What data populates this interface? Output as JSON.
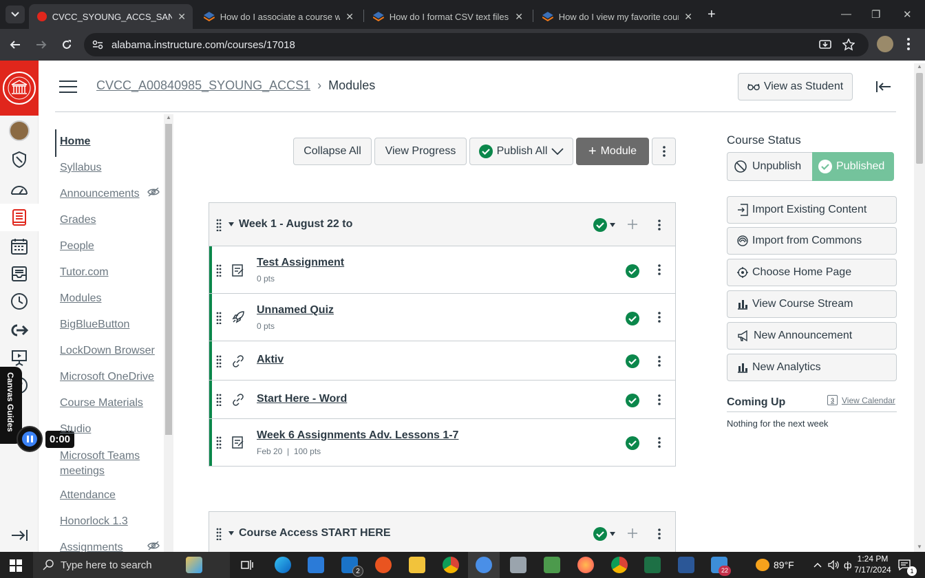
{
  "browser": {
    "tabs": [
      {
        "title": "CVCC_SYOUNG_ACCS_SANDBOX",
        "active": true
      },
      {
        "title": "How do I associate a course with",
        "active": false
      },
      {
        "title": "How do I format CSV text files f",
        "active": false
      },
      {
        "title": "How do I view my favorite cour",
        "active": false
      }
    ],
    "new_tab": "+",
    "url": "alabama.instructure.com/courses/17018"
  },
  "header": {
    "course": "CVCC_A00840985_SYOUNG_ACCS1",
    "separator": "›",
    "page": "Modules",
    "view_as_student": "View as Student"
  },
  "course_nav": [
    {
      "label": "Home",
      "active": true,
      "hidden": false
    },
    {
      "label": "Syllabus",
      "hidden": false
    },
    {
      "label": "Announcements",
      "hidden": true
    },
    {
      "label": "Grades",
      "hidden": false
    },
    {
      "label": "People",
      "hidden": false
    },
    {
      "label": "Tutor.com",
      "hidden": false
    },
    {
      "label": "Modules",
      "hidden": false
    },
    {
      "label": "BigBlueButton",
      "hidden": false
    },
    {
      "label": "LockDown Browser",
      "hidden": false
    },
    {
      "label": "Microsoft OneDrive",
      "hidden": false
    },
    {
      "label": "Course Materials",
      "hidden": false
    },
    {
      "label": "Studio",
      "hidden": false
    },
    {
      "label": "Microsoft Teams meetings",
      "hidden": false
    },
    {
      "label": "Attendance",
      "hidden": false
    },
    {
      "label": "Honorlock 1.3",
      "hidden": false
    },
    {
      "label": "Assignments",
      "hidden": true
    }
  ],
  "toolbar": {
    "collapse_all": "Collapse All",
    "view_progress": "View Progress",
    "publish_all": "Publish All",
    "add_module": "Module"
  },
  "modules": [
    {
      "name": "Week 1 - August 22 to",
      "items": [
        {
          "type": "assignment",
          "title": "Test Assignment",
          "meta": "0 pts"
        },
        {
          "type": "quiz",
          "title": "Unnamed Quiz",
          "meta": "0 pts"
        },
        {
          "type": "link",
          "title": "Aktiv",
          "meta": ""
        },
        {
          "type": "link",
          "title": "Start Here - Word",
          "meta": ""
        },
        {
          "type": "assignment",
          "title": "Week 6 Assignments Adv. Lessons 1-7",
          "meta": "Feb 20  |  100 pts"
        }
      ]
    },
    {
      "name": "Course Access START HERE",
      "items": []
    }
  ],
  "sidebar": {
    "status_title": "Course Status",
    "unpublish": "Unpublish",
    "published": "Published",
    "actions": [
      {
        "label": "Import Existing Content",
        "icon": "import-icon"
      },
      {
        "label": "Import from Commons",
        "icon": "commons-icon"
      },
      {
        "label": "Choose Home Page",
        "icon": "target-icon"
      },
      {
        "label": "View Course Stream",
        "icon": "bar-chart-icon"
      },
      {
        "label": "New Announcement",
        "icon": "megaphone-icon"
      },
      {
        "label": "New Analytics",
        "icon": "bar-chart-icon"
      }
    ],
    "coming_up": "Coming Up",
    "view_calendar": "View Calendar",
    "calendar_day": "3",
    "nothing": "Nothing for the next week"
  },
  "overlay": {
    "guides_label": "Canvas Guides",
    "timer": "0:00"
  },
  "taskbar": {
    "search_placeholder": "Type here to search",
    "mail_badge": "2",
    "teams_badge": "22",
    "weather": "89°F",
    "time": "1:24 PM",
    "date": "7/17/2024",
    "notif_badge": "1"
  },
  "colors": {
    "canvas_red": "#e0261c",
    "success_green": "#0b874b",
    "published_bg": "#74c39c",
    "chrome_dark": "#202124"
  }
}
